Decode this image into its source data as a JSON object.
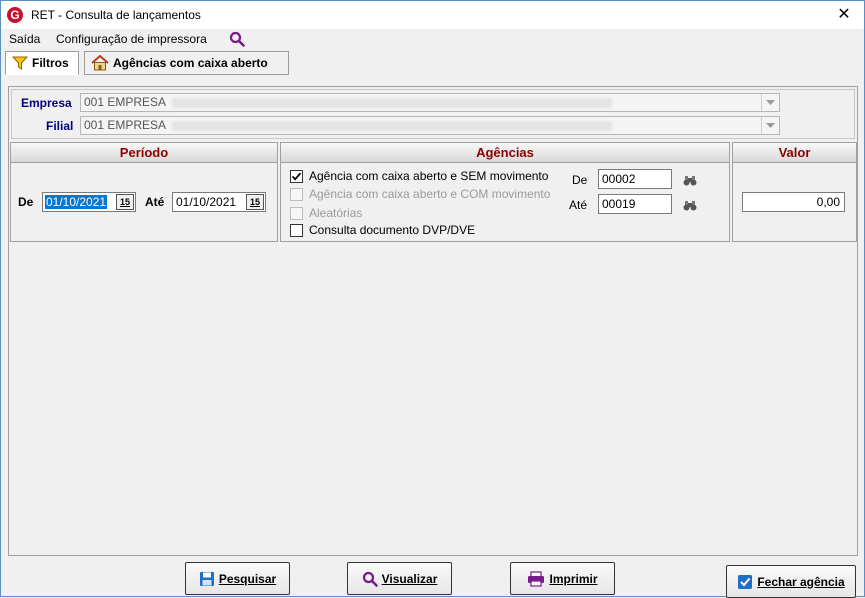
{
  "window": {
    "title": "RET - Consulta de lançamentos",
    "icon_letter": "G",
    "close": "✕"
  },
  "menu": {
    "items": [
      "Saída",
      "Configuração de impressora"
    ]
  },
  "tabs": [
    {
      "label": "Filtros",
      "active": true
    },
    {
      "label": "Agências com caixa aberto",
      "active": false
    }
  ],
  "empresa": {
    "label": "Empresa",
    "value": "001 EMPRESA"
  },
  "filial": {
    "label": "Filial",
    "value": "001 EMPRESA"
  },
  "periodo": {
    "header": "Período",
    "de_label": "De",
    "de_value": "01/10/2021",
    "ate_label": "Até",
    "ate_value": "01/10/2021",
    "cal_glyph": "15"
  },
  "agencias": {
    "header": "Agências",
    "options": [
      {
        "label": "Agência com caixa aberto e SEM movimento",
        "checked": true,
        "enabled": true
      },
      {
        "label": "Agência com caixa aberto e COM movimento",
        "checked": false,
        "enabled": false
      },
      {
        "label": "Aleatórias",
        "checked": false,
        "enabled": false
      },
      {
        "label": "Consulta documento DVP/DVE",
        "checked": false,
        "enabled": true
      }
    ],
    "de_label": "De",
    "de_value": "00002",
    "ate_label": "Até",
    "ate_value": "00019"
  },
  "valor": {
    "header": "Valor",
    "value": "0,00"
  },
  "buttons": {
    "pesquisar": "Pesquisar",
    "visualizar": "Visualizar",
    "imprimir": "Imprimir",
    "fechar": "Fechar agência"
  },
  "colors": {
    "header_text": "#8b0000",
    "field_label": "#000080",
    "selection": "#0078d7"
  }
}
